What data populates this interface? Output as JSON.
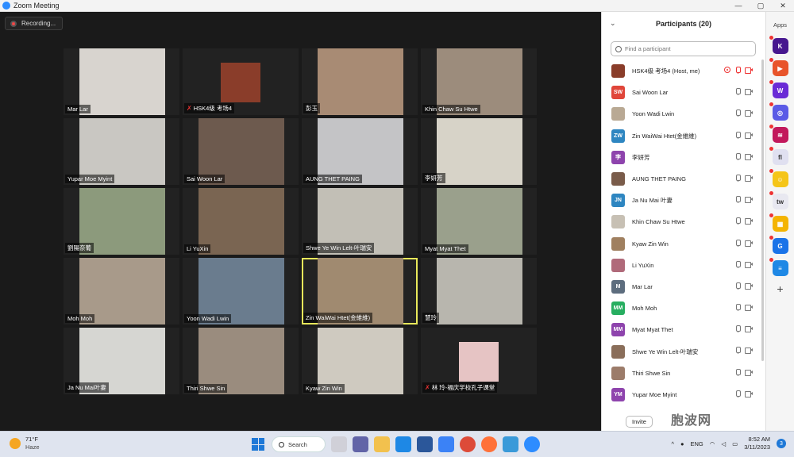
{
  "window": {
    "title": "Zoom Meeting",
    "controls": [
      "—",
      "▢",
      "✕"
    ]
  },
  "meeting": {
    "recording_label": "Recording...",
    "tiles": [
      {
        "name": "Mar Lar",
        "muted": false,
        "color": "#d8d4cf",
        "type": "video"
      },
      {
        "name": "HSK4级 考场4",
        "muted": true,
        "color": "#8a3d2a",
        "type": "avatar"
      },
      {
        "name": "彭玉",
        "muted": false,
        "color": "#a88b74",
        "type": "video"
      },
      {
        "name": "Khin Chaw Su Htwe",
        "muted": false,
        "color": "#9c8c7c",
        "type": "video"
      },
      {
        "name": "Yupar Moe Myint",
        "muted": false,
        "color": "#c9c7c2",
        "type": "video"
      },
      {
        "name": "Sai Woon Lar",
        "muted": false,
        "color": "#6d5a4e",
        "type": "video"
      },
      {
        "name": "AUNG THET PAING",
        "muted": false,
        "color": "#c4c4c6",
        "type": "video"
      },
      {
        "name": "李妍芳",
        "muted": false,
        "color": "#d7d3c8",
        "type": "video"
      },
      {
        "name": "劉陽奈葡",
        "muted": false,
        "color": "#8c9a7c",
        "type": "video"
      },
      {
        "name": "Li YuXin",
        "muted": false,
        "color": "#7a6552",
        "type": "video"
      },
      {
        "name": "Shwe Ye Win Lelt-叶瑞安",
        "muted": false,
        "color": "#c2bfb6",
        "type": "video"
      },
      {
        "name": "Myat Myat Thet",
        "muted": false,
        "color": "#9aa08c",
        "type": "video"
      },
      {
        "name": "Moh Moh",
        "muted": false,
        "color": "#a89a8a",
        "type": "video"
      },
      {
        "name": "Yoon Wadi Lwin",
        "muted": false,
        "color": "#6a7c8e",
        "type": "video"
      },
      {
        "name": "Zin WaiWai Htet(金維維)",
        "muted": false,
        "color": "#a08a70",
        "type": "video"
      },
      {
        "name": "慧玲",
        "muted": false,
        "color": "#b8b6ae",
        "type": "video"
      },
      {
        "name": "Ja Nu Mai叶妻",
        "muted": false,
        "color": "#d6d6d2",
        "type": "video"
      },
      {
        "name": "Thiri Shwe Sin",
        "muted": false,
        "color": "#9a8c7e",
        "type": "video"
      },
      {
        "name": "Kyaw Zin Win",
        "muted": false,
        "color": "#cfcac0",
        "type": "video"
      },
      {
        "name": "林 玲-福庆学校孔子课堂",
        "muted": true,
        "color": "#e6c4c4",
        "type": "avatar"
      }
    ]
  },
  "participants": {
    "title": "Participants (20)",
    "search_placeholder": "Find a participant",
    "invite_label": "Invite",
    "list": [
      {
        "name": "HSK4级 考场4 (Host, me)",
        "initials": "",
        "avatar_color": "#8a3d2a",
        "recording": true,
        "mic_red": true,
        "cam_red": true
      },
      {
        "name": "Sai Woon Lar",
        "initials": "SW",
        "avatar_color": "#e0463a",
        "recording": false,
        "mic_red": false,
        "cam_red": false
      },
      {
        "name": "Yoon Wadi Lwin",
        "initials": "",
        "avatar_color": "#b9a994",
        "recording": false,
        "mic_red": false,
        "cam_red": false
      },
      {
        "name": "Zin WaiWai Htet(金維維)",
        "initials": "ZW",
        "avatar_color": "#2e86c1",
        "recording": false,
        "mic_red": false,
        "cam_red": false
      },
      {
        "name": "李妍芳",
        "initials": "李",
        "avatar_color": "#8e44ad",
        "recording": false,
        "mic_red": false,
        "cam_red": false
      },
      {
        "name": "AUNG THET PAING",
        "initials": "",
        "avatar_color": "#7a5c4a",
        "recording": false,
        "mic_red": false,
        "cam_red": false
      },
      {
        "name": "Ja Nu Mai 叶妻",
        "initials": "JN",
        "avatar_color": "#2e86c1",
        "recording": false,
        "mic_red": false,
        "cam_red": false
      },
      {
        "name": "Khin Chaw Su Htwe",
        "initials": "",
        "avatar_color": "#c7c0b4",
        "recording": false,
        "mic_red": false,
        "cam_red": false
      },
      {
        "name": "Kyaw Zin Win",
        "initials": "",
        "avatar_color": "#a08060",
        "recording": false,
        "mic_red": false,
        "cam_red": false
      },
      {
        "name": "Li YuXin",
        "initials": "",
        "avatar_color": "#b06a7a",
        "recording": false,
        "mic_red": false,
        "cam_red": false
      },
      {
        "name": "Mar Lar",
        "initials": "M",
        "avatar_color": "#5d6d7e",
        "recording": false,
        "mic_red": false,
        "cam_red": false
      },
      {
        "name": "Moh Moh",
        "initials": "MM",
        "avatar_color": "#27ae60",
        "recording": false,
        "mic_red": false,
        "cam_red": false
      },
      {
        "name": "Myat Myat Thet",
        "initials": "MM",
        "avatar_color": "#8e44ad",
        "recording": false,
        "mic_red": false,
        "cam_red": false
      },
      {
        "name": "Shwe Ye Win Lelt-叶瑞安",
        "initials": "",
        "avatar_color": "#8a6e5a",
        "recording": false,
        "mic_red": false,
        "cam_red": false
      },
      {
        "name": "Thiri Shwe Sin",
        "initials": "",
        "avatar_color": "#9c7c6a",
        "recording": false,
        "mic_red": false,
        "cam_red": false
      },
      {
        "name": "Yupar Moe Myint",
        "initials": "YM",
        "avatar_color": "#8e44ad",
        "recording": false,
        "mic_red": false,
        "cam_red": false
      }
    ]
  },
  "apps": {
    "label": "Apps",
    "items": [
      {
        "icon": "kahoot-icon",
        "text": "K",
        "color": "#46178f"
      },
      {
        "icon": "app-orange-icon",
        "text": "▶",
        "color": "#e8542a"
      },
      {
        "icon": "w-app-icon",
        "text": "W",
        "color": "#6a2bd6"
      },
      {
        "icon": "chat-app-icon",
        "text": "◎",
        "color": "#5b5be6"
      },
      {
        "icon": "wifi-app-icon",
        "text": "≋",
        "color": "#c2185b"
      },
      {
        "icon": "flesh-app-icon",
        "text": "fl",
        "color": "#e0e0f0"
      },
      {
        "icon": "smile-app-icon",
        "text": "☺",
        "color": "#f5c518"
      },
      {
        "icon": "twine-app-icon",
        "text": "tw",
        "color": "#e8e8f0"
      },
      {
        "icon": "grid-app-icon",
        "text": "▦",
        "color": "#f4b400"
      },
      {
        "icon": "g-app-icon",
        "text": "G",
        "color": "#1a73e8"
      },
      {
        "icon": "box-app-icon",
        "text": "≡",
        "color": "#1e88e5"
      }
    ],
    "add_label": "+"
  },
  "taskbar": {
    "temperature": "71°F",
    "condition": "Haze",
    "search_label": "Search",
    "language": "ENG",
    "time": "8:52 AM",
    "date": "3/11/2023",
    "notifications": "3"
  },
  "watermark": "胞波网"
}
